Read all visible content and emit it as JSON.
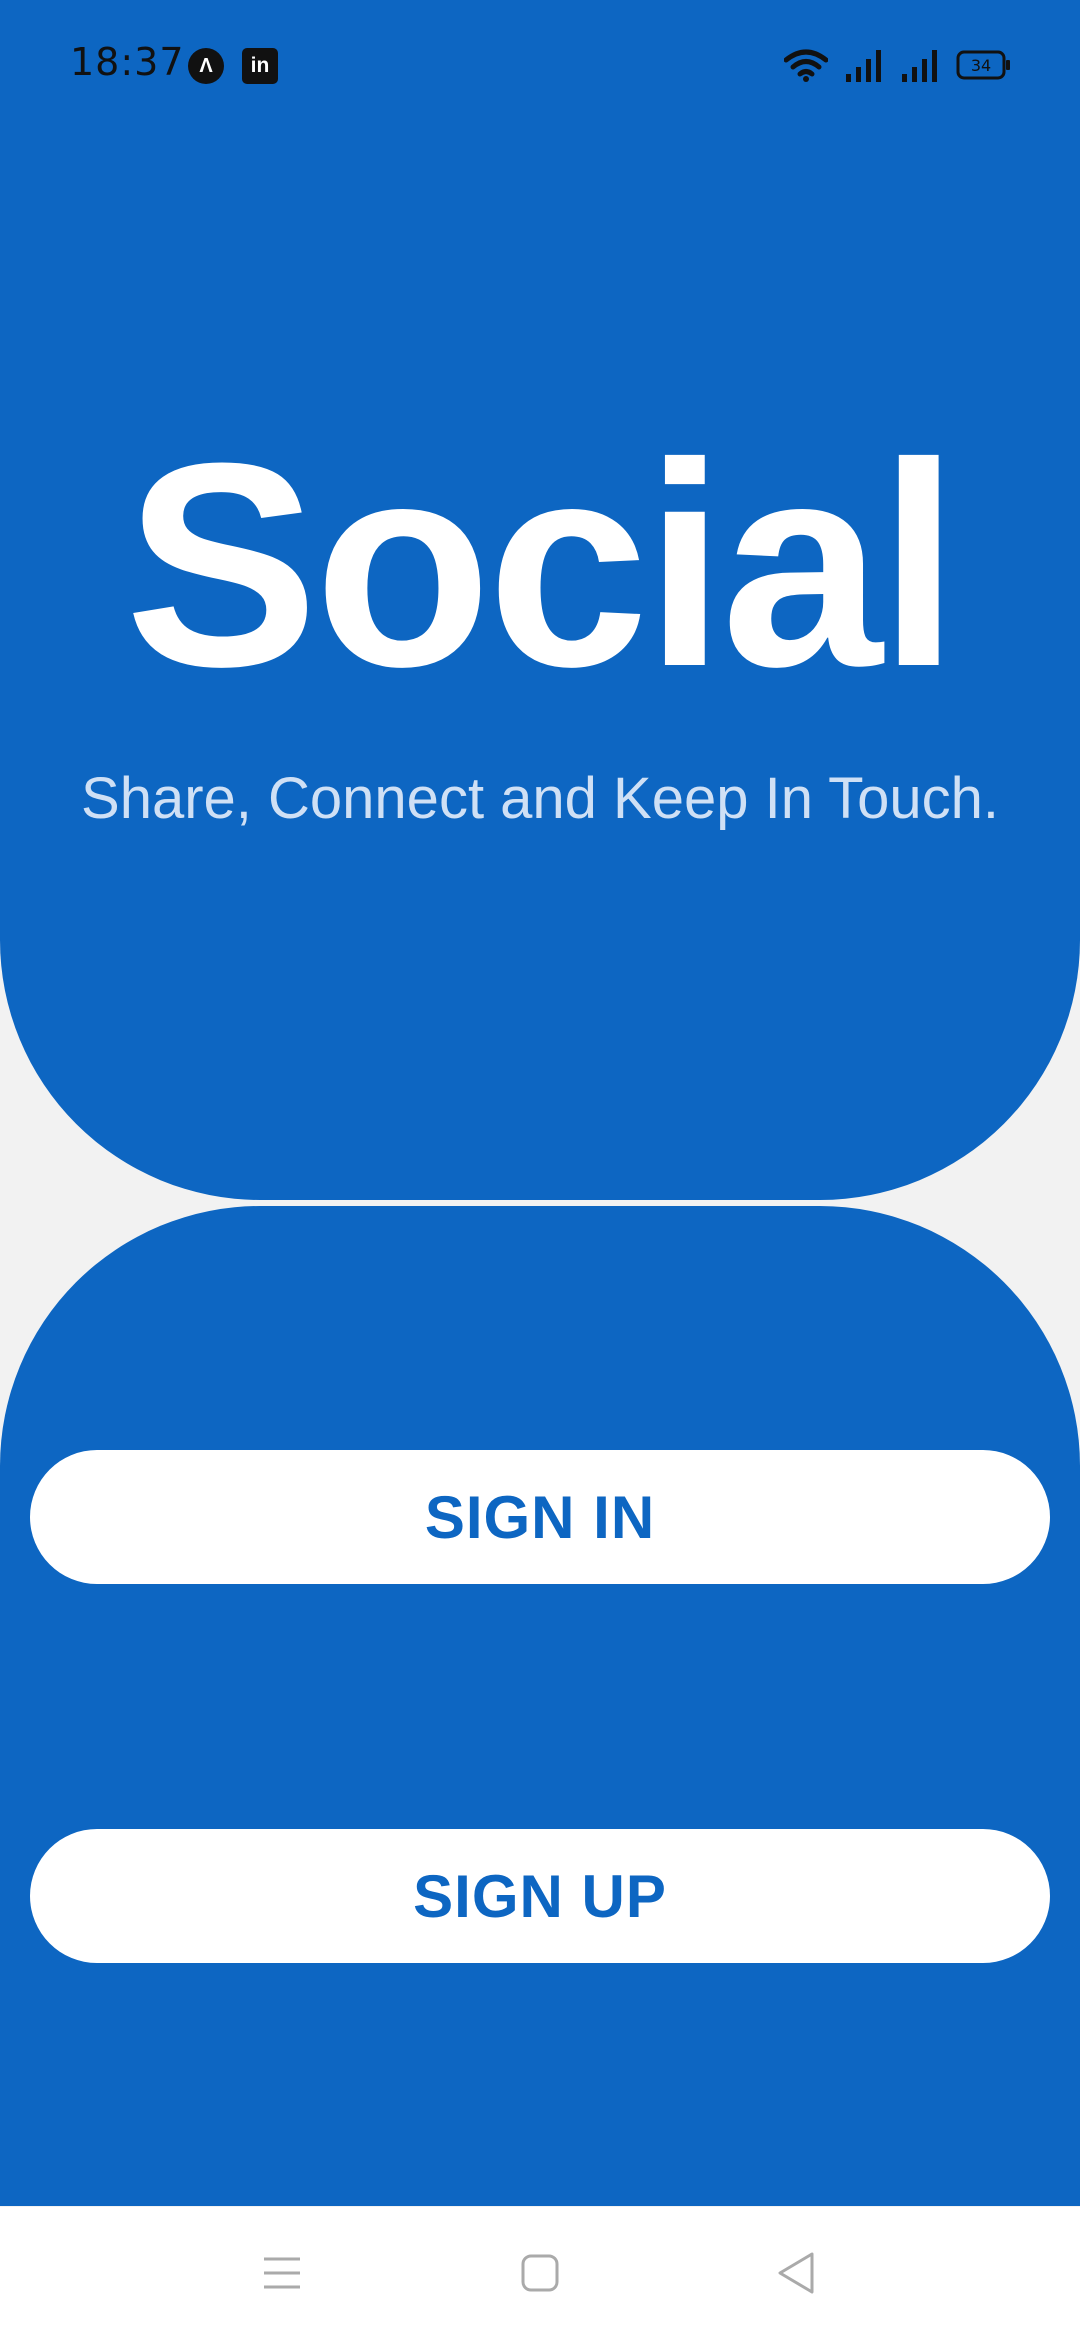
{
  "status_bar": {
    "time": "18:37",
    "notification_icons": [
      "app-a-icon",
      "linkedin-icon"
    ],
    "app_a_glyph": "Λ",
    "linkedin_glyph": "in",
    "battery_level": "34",
    "system_icons": [
      "wifi-icon",
      "signal-icon",
      "signal-icon",
      "battery-icon"
    ]
  },
  "hero": {
    "title": "Social",
    "tagline": "Share, Connect and Keep In Touch."
  },
  "actions": {
    "sign_in_label": "SIGN IN",
    "sign_up_label": "SIGN UP"
  },
  "navigation_bar": {
    "buttons": [
      "menu-icon",
      "home-icon",
      "back-icon"
    ]
  },
  "colors": {
    "primary": "#0d66c2",
    "background": "#f2f2f2",
    "button_background": "#ffffff",
    "tagline": "#cfe0f5"
  }
}
